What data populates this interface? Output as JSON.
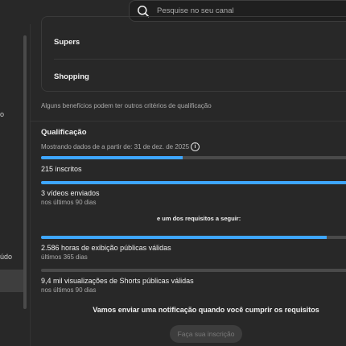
{
  "search": {
    "placeholder": "Pesquise no seu canal",
    "icon": "search-icon"
  },
  "sidebar": {
    "fragments": [
      "o",
      "údo"
    ]
  },
  "benefits_card": {
    "rows": [
      "Supers",
      "Shopping"
    ]
  },
  "benefits_note": "Alguns benefícios podem ter outros critérios de qualificação",
  "qualification": {
    "title": "Qualificação",
    "data_note": "Mostrando dados de a partir de: 31 de dez. de 2025",
    "info_icon": "i",
    "requirements": [
      {
        "label": "215 inscritos",
        "sub": "",
        "progress": 0.45
      },
      {
        "label": "3 vídeos enviados",
        "sub": "nos últimos 90 dias",
        "progress": 1.0
      },
      {
        "label": "2.586 horas de exibição públicas válidas",
        "sub": "últimos 365 dias",
        "progress": 0.91
      },
      {
        "label": "9,4 mil visualizações de Shorts públicas válidas",
        "sub": "nos últimos 90 dias",
        "progress": 0.0
      }
    ],
    "either_label": "e um dos requisitos a seguir:",
    "notify_text": "Vamos enviar uma notificação quando você cumprir os requisitos",
    "apply_label": "Faça sua inscrição"
  },
  "colors": {
    "accent": "#3ea6ff",
    "background": "#282828",
    "track": "#4a4a4a"
  }
}
